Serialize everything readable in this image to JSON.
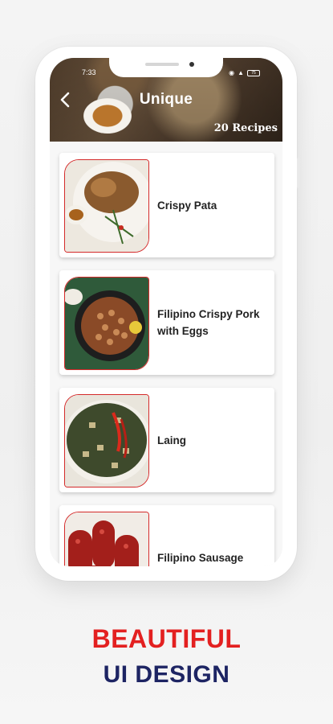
{
  "header": {
    "title": "Unique",
    "recipe_count": "20 Recipes",
    "status_time": "7:33",
    "battery": "75"
  },
  "recipes": [
    {
      "name": "Crispy Pata"
    },
    {
      "name": "Filipino Crispy Pork with Eggs"
    },
    {
      "name": "Laing"
    },
    {
      "name": "Filipino Sausage"
    }
  ],
  "promo": {
    "line1": "BEAUTIFUL",
    "line2": "UI DESIGN"
  },
  "colors": {
    "accent_red": "#e32020",
    "navy": "#1d2463",
    "card_border": "#d42a2a"
  }
}
